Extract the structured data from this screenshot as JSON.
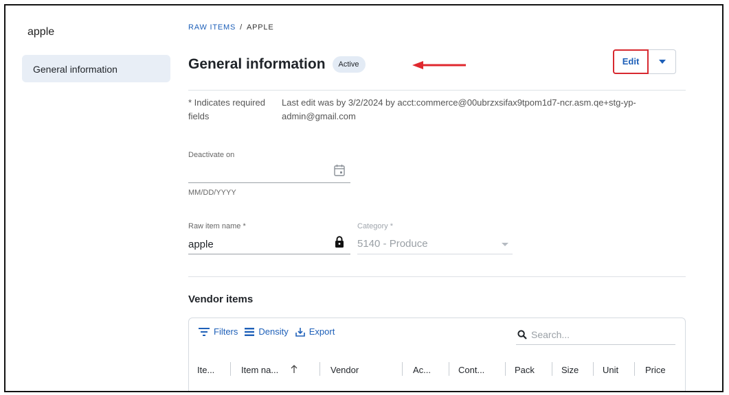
{
  "sidebar": {
    "title": "apple",
    "items": [
      {
        "label": "General information"
      }
    ]
  },
  "breadcrumb": {
    "parent": "RAW ITEMS",
    "separator": "/",
    "current": "APPLE"
  },
  "header": {
    "title": "General information",
    "status": "Active",
    "edit_label": "Edit"
  },
  "meta": {
    "required_note": "* Indicates required fields",
    "last_edit": "Last edit was by 3/2/2024 by acct:commerce@00ubrzxsifax9tpom1d7-ncr.asm.qe+stg-yp-admin@gmail.com"
  },
  "fields": {
    "deactivate": {
      "label": "Deactivate on",
      "value": "",
      "helper": "MM/DD/YYYY"
    },
    "raw_item_name": {
      "label": "Raw item name *",
      "value": "apple"
    },
    "category": {
      "label": "Category *",
      "value": "5140 - Produce"
    }
  },
  "vendor_items": {
    "title": "Vendor items",
    "toolbar": {
      "filters": "Filters",
      "density": "Density",
      "export": "Export"
    },
    "search_placeholder": "Search...",
    "columns": [
      "Ite...",
      "Item na...",
      "Vendor",
      "Ac...",
      "Cont...",
      "Pack",
      "Size",
      "Unit",
      "Price"
    ]
  },
  "colors": {
    "accent": "#1d5fb8",
    "highlight": "#d7282f",
    "sidebar_selected": "#e8eef6",
    "badge": "#e3ebf5"
  }
}
